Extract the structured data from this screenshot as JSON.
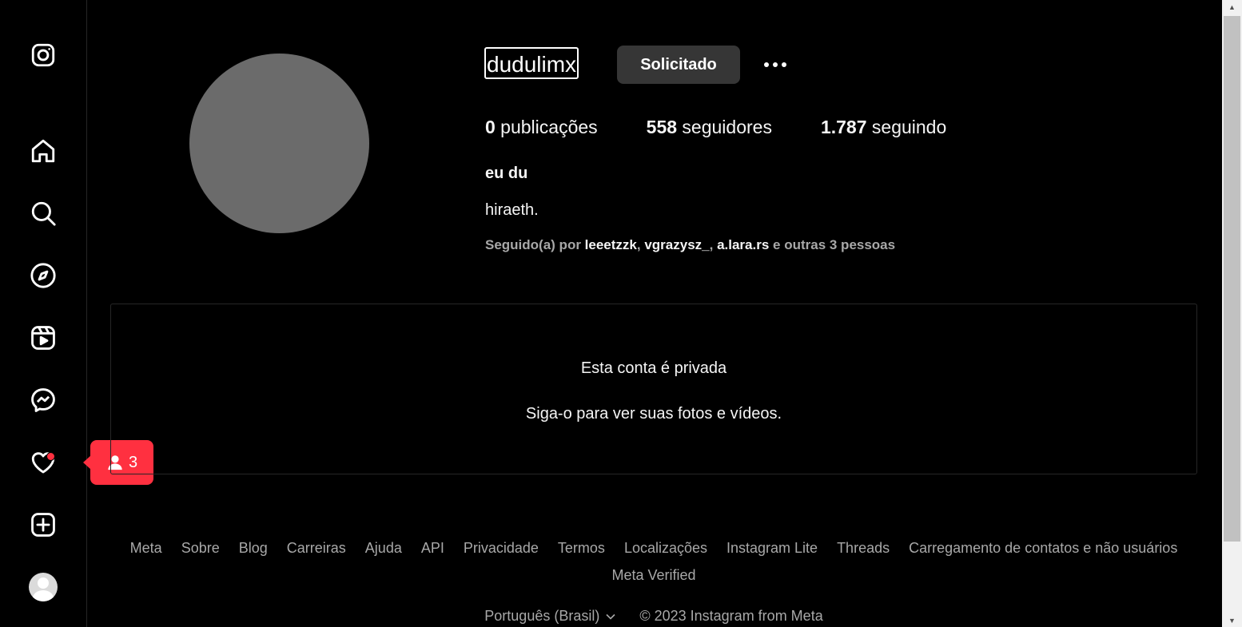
{
  "sidebar": {
    "icons": [
      "instagram-logo-icon",
      "home-icon",
      "search-icon",
      "explore-icon",
      "reels-icon",
      "messenger-icon",
      "heart-icon",
      "new-post-icon",
      "profile-avatar"
    ],
    "notification_count": "3"
  },
  "profile": {
    "username": "dudulimx",
    "follow_button_label": "Solicitado",
    "stats": [
      {
        "count": "0",
        "label": " publicações"
      },
      {
        "count": "558",
        "label": " seguidores"
      },
      {
        "count": "1.787",
        "label": " seguindo"
      }
    ],
    "full_name": "eu du",
    "bio": "hiraeth.",
    "followed_by": {
      "prefix": "Seguido(a) por ",
      "accounts": [
        "leeetzzk",
        "vgrazysz_",
        "a.lara.rs"
      ],
      "separator": ", ",
      "suffix": " e outras 3 pessoas"
    }
  },
  "private_notice": {
    "title": "Esta conta é privada",
    "subtitle": "Siga-o para ver suas fotos e vídeos."
  },
  "footer": {
    "links": [
      "Meta",
      "Sobre",
      "Blog",
      "Carreiras",
      "Ajuda",
      "API",
      "Privacidade",
      "Termos",
      "Localizações",
      "Instagram Lite",
      "Threads",
      "Carregamento de contatos e não usuários",
      "Meta Verified"
    ],
    "language": "Português (Brasil)",
    "copyright": "© 2023 Instagram from Meta"
  },
  "colors": {
    "background": "#000000",
    "notification": "#ff3040",
    "button": "#363636",
    "secondary_text": "#a8a8a8"
  }
}
